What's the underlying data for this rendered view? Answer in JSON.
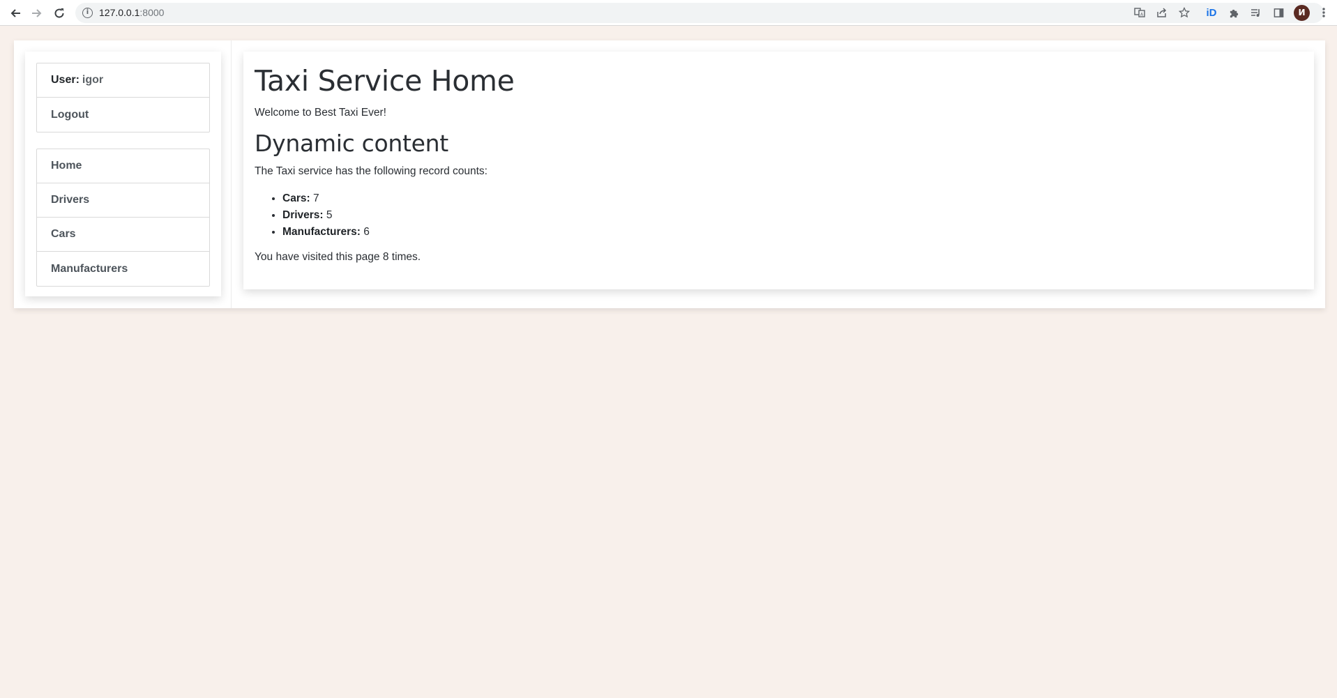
{
  "browser": {
    "url_host": "127.0.0.1",
    "url_port": ":8000",
    "avatar_letter": "И",
    "icons": [
      "back-icon",
      "forward-icon",
      "reload-icon",
      "info-icon",
      "translate-icon",
      "share-icon",
      "star-icon",
      "extension-id-icon",
      "puzzle-icon",
      "media-queue-icon",
      "side-panel-icon",
      "menu-icon"
    ]
  },
  "sidebar": {
    "user_key": "User:",
    "user_name": "igor",
    "logout": "Logout",
    "nav": [
      {
        "label": "Home"
      },
      {
        "label": "Drivers"
      },
      {
        "label": "Cars"
      },
      {
        "label": "Manufacturers"
      }
    ]
  },
  "main": {
    "title": "Taxi Service Home",
    "welcome": "Welcome to Best Taxi Ever!",
    "subtitle": "Dynamic content",
    "intro": "The Taxi service has the following record counts:",
    "counts": [
      {
        "label": "Cars:",
        "value": "7"
      },
      {
        "label": "Drivers:",
        "value": "5"
      },
      {
        "label": "Manufacturers:",
        "value": "6"
      }
    ],
    "visits": "You have visited this page 8 times."
  },
  "colors": {
    "page_background": "#f8f0eb",
    "card_background": "#ffffff",
    "text": "#2a2e33",
    "nav_text": "#4d545b"
  }
}
